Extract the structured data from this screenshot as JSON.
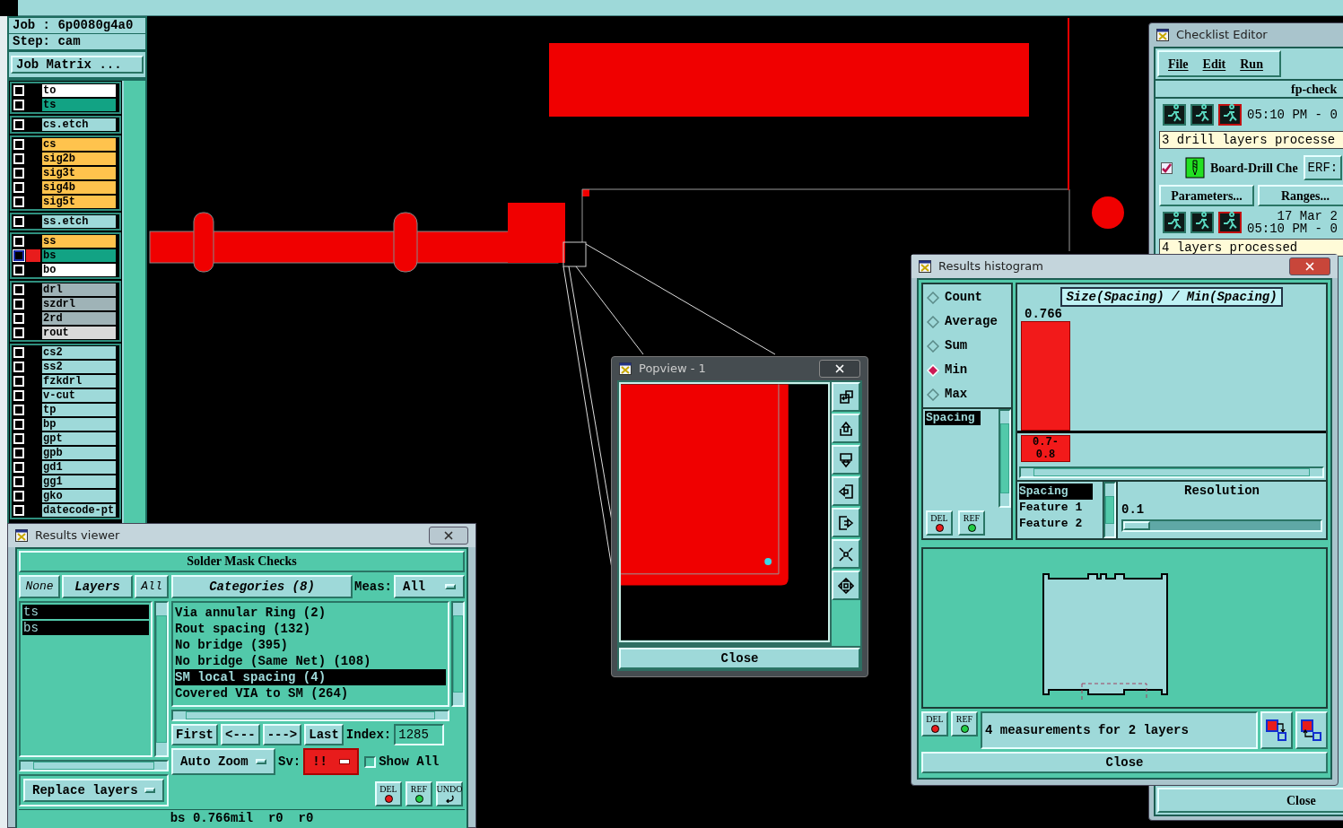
{
  "job": {
    "job_label": "Job : 6p0080g4a0",
    "step_label": "Step: cam",
    "matrix_button": "Job Matrix ..."
  },
  "layer_groups": [
    {
      "layers": [
        {
          "name": "to",
          "color": "#ffffff",
          "selected": false
        },
        {
          "name": "ts",
          "color": "#12a384",
          "selected": false
        }
      ]
    },
    {
      "layers": [
        {
          "name": "cs.etch",
          "color": "#9ed9d9",
          "selected": false
        }
      ]
    },
    {
      "layers": [
        {
          "name": "cs",
          "color": "#ffc34d",
          "selected": false
        },
        {
          "name": "sig2b",
          "color": "#ffc34d",
          "selected": false
        },
        {
          "name": "sig3t",
          "color": "#ffc34d",
          "selected": false
        },
        {
          "name": "sig4b",
          "color": "#ffc34d",
          "selected": false
        },
        {
          "name": "sig5t",
          "color": "#ffc34d",
          "selected": false
        }
      ]
    },
    {
      "layers": [
        {
          "name": "ss.etch",
          "color": "#9ed9d9",
          "selected": false
        }
      ]
    },
    {
      "layers": [
        {
          "name": "ss",
          "color": "#ffc34d",
          "selected": false
        },
        {
          "name": "bs",
          "color": "#12a384",
          "selected": true
        },
        {
          "name": "bo",
          "color": "#ffffff",
          "selected": false
        }
      ]
    },
    {
      "layers": [
        {
          "name": "drl",
          "color": "#9fb3b7",
          "selected": false
        },
        {
          "name": "szdrl",
          "color": "#9fb3b7",
          "selected": false
        },
        {
          "name": "2rd",
          "color": "#9fb3b7",
          "selected": false
        },
        {
          "name": "rout",
          "color": "#d9d9d9",
          "selected": false
        }
      ]
    },
    {
      "layers": [
        {
          "name": "cs2",
          "color": "#9ed9d9",
          "selected": false
        },
        {
          "name": "ss2",
          "color": "#9ed9d9",
          "selected": false
        },
        {
          "name": "fzkdrl",
          "color": "#9ed9d9",
          "selected": false
        },
        {
          "name": "v-cut",
          "color": "#9ed9d9",
          "selected": false
        },
        {
          "name": "tp",
          "color": "#9ed9d9",
          "selected": false
        },
        {
          "name": "bp",
          "color": "#9ed9d9",
          "selected": false
        },
        {
          "name": "gpt",
          "color": "#9ed9d9",
          "selected": false
        },
        {
          "name": "gpb",
          "color": "#9ed9d9",
          "selected": false
        },
        {
          "name": "gd1",
          "color": "#9ed9d9",
          "selected": false
        },
        {
          "name": "gg1",
          "color": "#9ed9d9",
          "selected": false
        },
        {
          "name": "gko",
          "color": "#9ed9d9",
          "selected": false
        },
        {
          "name": "datecode-pt",
          "color": "#9ed9d9",
          "selected": false
        }
      ]
    }
  ],
  "results_viewer": {
    "title": "Results viewer",
    "header": "Solder Mask Checks",
    "none_button": "None",
    "layers_button": "Layers",
    "all_button": "All",
    "layers": [
      {
        "name": "ts",
        "selected": true
      },
      {
        "name": "bs",
        "selected": true
      }
    ],
    "categories_button": "Categories (8)",
    "meas_label": "Meas:",
    "meas_value": "All",
    "categories": [
      {
        "name": "Via annular Ring (2)",
        "selected": false
      },
      {
        "name": "Rout spacing (132)",
        "selected": false
      },
      {
        "name": "No bridge (395)",
        "selected": false
      },
      {
        "name": "No bridge (Same Net) (108)",
        "selected": false
      },
      {
        "name": "SM local spacing (4)",
        "selected": true
      },
      {
        "name": "Covered VIA to SM (264)",
        "selected": false
      }
    ],
    "nav_buttons": [
      "First",
      "<---",
      "--->",
      "Last"
    ],
    "index_label": "Index:",
    "index_value": "1285",
    "auto_zoom": "Auto Zoom",
    "sv_label": "Sv:",
    "sv_value": "!!",
    "show_all": {
      "label": "Show All",
      "checked": false
    },
    "replace_layers": "Replace layers",
    "tool_buttons": [
      {
        "label": "DEL",
        "kind": "dot",
        "color": "#e81c1c"
      },
      {
        "label": "REF",
        "kind": "dot",
        "color": "#22cc44"
      },
      {
        "label": "UNDO",
        "kind": "undo"
      }
    ],
    "status": "bs 0.766mil  r0  r0"
  },
  "popview": {
    "title": "Popview - 1",
    "close": "Close"
  },
  "histogram": {
    "title": "Results histogram",
    "modes": [
      {
        "label": "Count",
        "selected": false
      },
      {
        "label": "Average",
        "selected": false
      },
      {
        "label": "Sum",
        "selected": false
      },
      {
        "label": "Min",
        "selected": true
      },
      {
        "label": "Max",
        "selected": false
      }
    ],
    "attributes": [
      {
        "label": "Spacing",
        "selected": true
      }
    ],
    "side_buttons": [
      {
        "label": "DEL",
        "color": "#e81c1c"
      },
      {
        "label": "REF",
        "color": "#22cc44"
      }
    ],
    "chart_title": "Size(Spacing) / Min(Spacing)",
    "bar_value": "0.766",
    "bar_range": "0.7-0.8",
    "fields": [
      {
        "label": "Spacing",
        "selected": true
      },
      {
        "label": "Feature 1",
        "selected": false
      },
      {
        "label": "Feature 2",
        "selected": false
      }
    ],
    "resolution_label": "Resolution",
    "resolution_value": "0.1",
    "resolution_slider": {
      "level": 0
    },
    "bottom_buttons": [
      {
        "label": "DEL",
        "color": "#e81c1c"
      },
      {
        "label": "REF",
        "color": "#22cc44"
      }
    ],
    "summary": "4 measurements for 2 layers",
    "close": "Close"
  },
  "checklist": {
    "title": "Checklist Editor",
    "menu": [
      "File",
      "Edit",
      "Run"
    ],
    "name": "fp-check",
    "first_run": {
      "lines": [
        "05:10 PM - 0"
      ],
      "message": "3 drill layers processe"
    },
    "action": {
      "checked": true,
      "name": "Board-Drill Che",
      "erf": "ERF:",
      "buttons": [
        "Parameters...",
        "Ranges..."
      ]
    },
    "second_run": {
      "lines": [
        "17 Mar 2",
        "05:10 PM - 0"
      ],
      "message": "4 layers processed"
    },
    "close": "Close"
  }
}
